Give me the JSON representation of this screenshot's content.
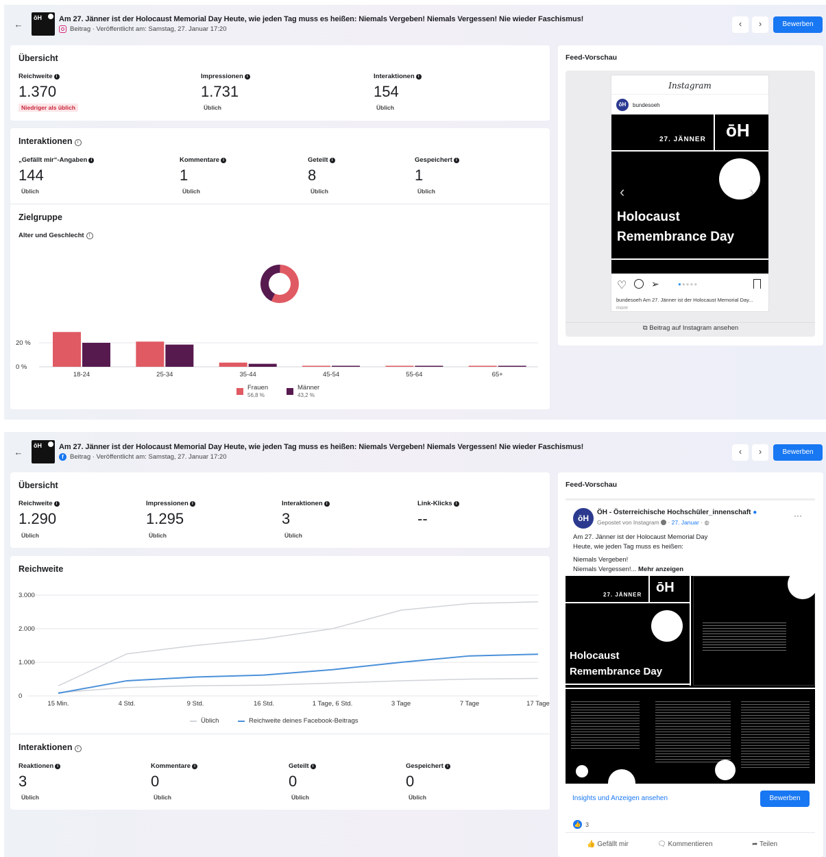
{
  "ig": {
    "header": {
      "title": "Am 27. Jänner ist der Holocaust Memorial Day Heute, wie jeden Tag muss es heißen: Niemals Vergeben! Niemals Vergessen! Nie wieder Faschismus!",
      "subtitle": "Beitrag · Veröffentlicht am: Samstag, 27. Januar 17:20",
      "prev": "‹",
      "next": "›",
      "button": "Bewerben"
    },
    "overview": {
      "title": "Übersicht",
      "metrics": [
        {
          "label": "Reichweite",
          "value": "1.370",
          "note": "Niedriger als üblich"
        },
        {
          "label": "Impressionen",
          "value": "1.731",
          "note": "Üblich"
        },
        {
          "label": "Interaktionen",
          "value": "154",
          "note": "Üblich"
        }
      ]
    },
    "interactions": {
      "title": "Interaktionen",
      "metrics": [
        {
          "label": "„Gefällt mir“-Angaben",
          "value": "144",
          "note": "Üblich"
        },
        {
          "label": "Kommentare",
          "value": "1",
          "note": "Üblich"
        },
        {
          "label": "Geteilt",
          "value": "8",
          "note": "Üblich"
        },
        {
          "label": "Gespeichert",
          "value": "1",
          "note": "Üblich"
        }
      ]
    },
    "audience": {
      "title": "Zielgruppe",
      "subtitle": "Alter und Geschlecht",
      "legend": [
        {
          "name": "Frauen",
          "pct": "56,8 %",
          "color": "#e05a63"
        },
        {
          "name": "Männer",
          "pct": "43,2 %",
          "color": "#571a4f"
        }
      ]
    },
    "feed": {
      "title": "Feed-Vorschau",
      "brand": "Instagram",
      "account": "bundesoeh",
      "post_date": "27. JÄNNER",
      "logo": "ōH",
      "headline1": "Holocaust",
      "headline2": "Remembrance Day",
      "caption_user": "bundesoeh",
      "caption": " Am 27. Jänner ist der Holocaust Memorial Day...",
      "caption_more": " more",
      "link": "Beitrag auf Instagram ansehen"
    }
  },
  "fb": {
    "header": {
      "title": "Am 27. Jänner ist der Holocaust Memorial Day Heute, wie jeden Tag muss es heißen: Niemals Vergeben! Niemals Vergessen! Nie wieder Faschismus!",
      "subtitle": "Beitrag · Veröffentlicht am: Samstag, 27. Januar 17:20",
      "prev": "‹",
      "next": "›",
      "button": "Bewerben"
    },
    "overview": {
      "title": "Übersicht",
      "metrics": [
        {
          "label": "Reichweite",
          "value": "1.290",
          "note": "Üblich"
        },
        {
          "label": "Impressionen",
          "value": "1.295",
          "note": "Üblich"
        },
        {
          "label": "Interaktionen",
          "value": "3",
          "note": "Üblich"
        },
        {
          "label": "Link-Klicks",
          "value": "--",
          "note": ""
        }
      ]
    },
    "reach": {
      "title": "Reichweite"
    },
    "interactions": {
      "title": "Interaktionen",
      "metrics": [
        {
          "label": "Reaktionen",
          "value": "3",
          "note": "Üblich"
        },
        {
          "label": "Kommentare",
          "value": "0",
          "note": "Üblich"
        },
        {
          "label": "Geteilt",
          "value": "0",
          "note": "Üblich"
        },
        {
          "label": "Gespeichert",
          "value": "0",
          "note": "Üblich"
        }
      ]
    },
    "feed": {
      "title": "Feed-Vorschau",
      "page_name": "ÖH - Österreichische Hochschüler_innenschaft",
      "posted_via": "Gepostet von Instagram",
      "posted_date": "27. Januar",
      "menu": "···",
      "text1": "Am 27. Jänner ist der Holocaust Memorial Day",
      "text2": "Heute, wie jeden Tag muss es heißen:",
      "text3": "Niemals Vergeben!",
      "text4": "Niemals Vergessen!...",
      "more": "Mehr anzeigen",
      "post_date": "27. JÄNNER",
      "logo": "ōH",
      "headline1": "Holocaust",
      "headline2": "Remembrance Day",
      "insights_link": "Insights und Anzeigen ansehen",
      "button": "Bewerben",
      "reactions_count": "3",
      "like": "Gefällt mir",
      "comment": "Kommentieren",
      "share": "Teilen"
    }
  },
  "chart_data": [
    {
      "type": "bar",
      "categories": [
        "18-24",
        "25-34",
        "35-44",
        "45-54",
        "55-64",
        "65+"
      ],
      "series": [
        {
          "name": "Frauen",
          "values": [
            29,
            21,
            3.5,
            0.8,
            0.5,
            0.5
          ],
          "color": "#e05a63"
        },
        {
          "name": "Männer",
          "values": [
            20,
            18.5,
            2.5,
            0.6,
            0.4,
            0.4
          ],
          "color": "#571a4f"
        }
      ],
      "yticks": [
        "0 %",
        "20 %"
      ],
      "ylim": [
        0,
        35
      ]
    },
    {
      "type": "pie",
      "series": [
        {
          "name": "Frauen",
          "value": 56.8,
          "color": "#e05a63"
        },
        {
          "name": "Männer",
          "value": 43.2,
          "color": "#571a4f"
        }
      ]
    },
    {
      "type": "line",
      "x": [
        "15 Min.",
        "4 Std.",
        "9 Std.",
        "16 Std.",
        "1 Tage, 6 Std.",
        "3 Tage",
        "7 Tage",
        "17 Tage"
      ],
      "yticks": [
        "0",
        "1.000",
        "2.000",
        "3.000"
      ],
      "ylim": [
        0,
        3000
      ],
      "series": [
        {
          "name": "Üblich",
          "color": "#d0d3d8",
          "values": [
            300,
            1250,
            1500,
            1700,
            2000,
            2550,
            2750,
            2800
          ]
        },
        {
          "name": "Üblich",
          "color": "#d0d3d8",
          "values": [
            100,
            250,
            300,
            320,
            380,
            450,
            500,
            520
          ]
        },
        {
          "name": "Reichweite deines Facebook-Beitrags",
          "color": "#4a90d9",
          "values": [
            80,
            450,
            560,
            620,
            780,
            1000,
            1190,
            1240
          ]
        }
      ]
    }
  ]
}
